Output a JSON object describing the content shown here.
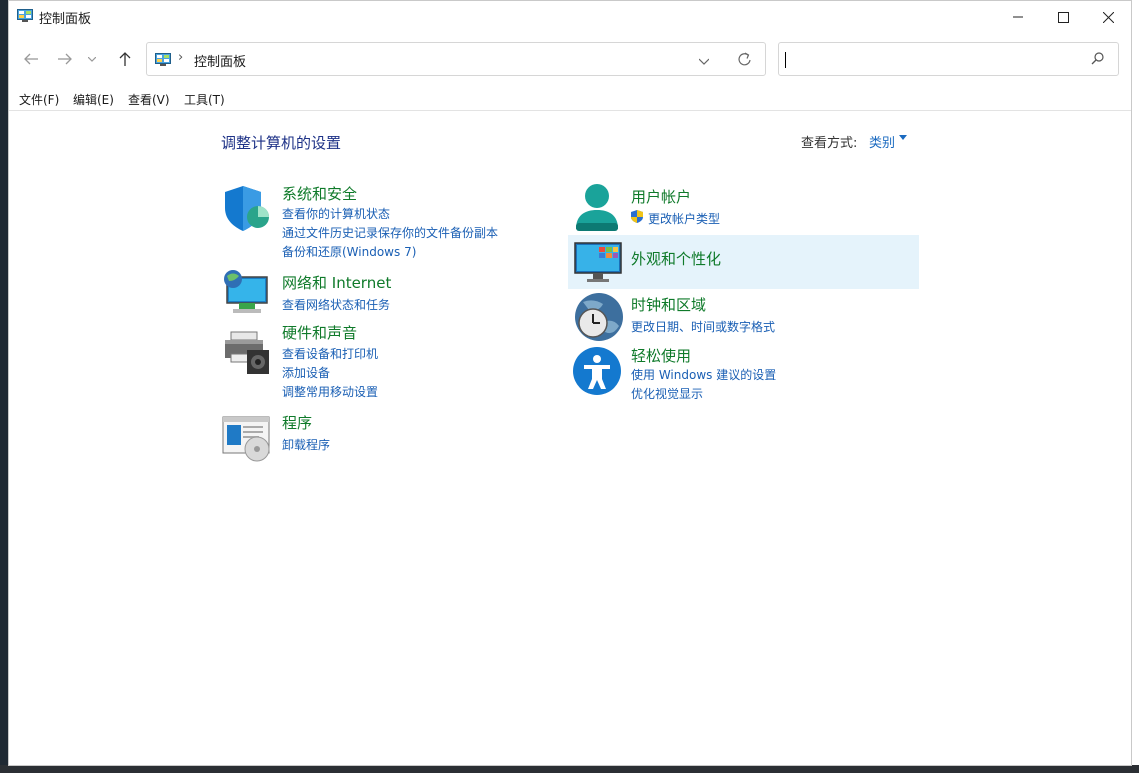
{
  "window": {
    "title": "控制面板"
  },
  "address": {
    "path": "控制面板",
    "search_placeholder": ""
  },
  "menu": [
    "文件(F)",
    "编辑(E)",
    "查看(V)",
    "工具(T)"
  ],
  "content": {
    "heading": "调整计算机的设置",
    "view_by_label": "查看方式:",
    "view_by_value": "类别"
  },
  "categories_left": [
    {
      "title": "系统和安全",
      "links": [
        "查看你的计算机状态",
        "通过文件历史记录保存你的文件备份副本",
        "备份和还原(Windows 7)"
      ]
    },
    {
      "title": "网络和 Internet",
      "links": [
        "查看网络状态和任务"
      ]
    },
    {
      "title": "硬件和声音",
      "links": [
        "查看设备和打印机",
        "添加设备",
        "调整常用移动设置"
      ]
    },
    {
      "title": "程序",
      "links": [
        "卸载程序"
      ]
    }
  ],
  "categories_right": [
    {
      "title": "用户帐户",
      "links": [
        "更改帐户类型"
      ]
    },
    {
      "title": "外观和个性化",
      "links": []
    },
    {
      "title": "时钟和区域",
      "links": [
        "更改日期、时间或数字格式"
      ]
    },
    {
      "title": "轻松使用",
      "links": [
        "使用 Windows 建议的设置",
        "优化视觉显示"
      ]
    }
  ],
  "colors": {
    "heading": "#1e3287",
    "category_title": "#0f7a2a",
    "link": "#1a5fb4",
    "hover_bg": "#e5f3fb"
  }
}
